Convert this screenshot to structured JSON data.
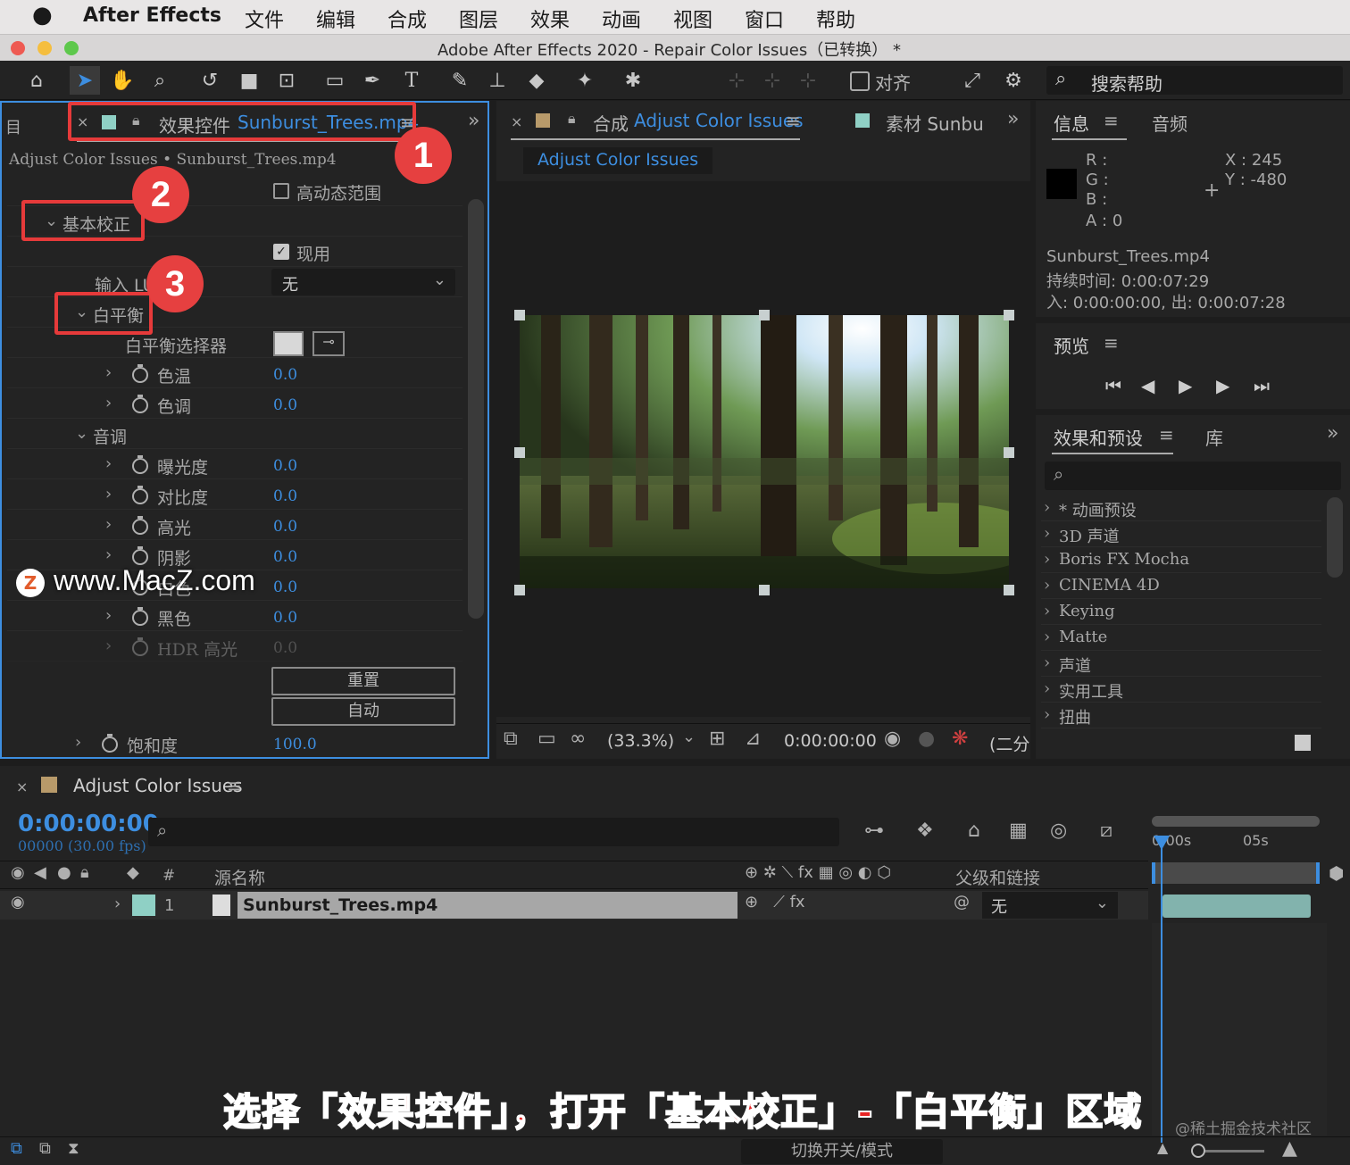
{
  "menubar": {
    "app_name": "After Effects",
    "items": [
      "文件",
      "编辑",
      "合成",
      "图层",
      "效果",
      "动画",
      "视图",
      "窗口",
      "帮助"
    ]
  },
  "window_title": "Adobe After Effects 2020 - Repair Color Issues（已转换） *",
  "toolbar": {
    "align_label": "对齐",
    "search_help": "搜索帮助"
  },
  "effect_controls": {
    "tab_prefix": "效果控件",
    "tab_file": "Sunburst_Trees.mp4",
    "breadcrumb": "Adjust Color Issues • Sunburst_Trees.mp4",
    "hdr_label": "高动态范围",
    "basic_correction": "基本校正",
    "enable_label": "现用",
    "input_lut_label": "输入 LUT",
    "input_lut_value": "无",
    "white_balance": "白平衡",
    "wb_picker": "白平衡选择器",
    "temperature": {
      "label": "色温",
      "value": "0.0"
    },
    "tint": {
      "label": "色调",
      "value": "0.0"
    },
    "tone": "音调",
    "exposure": {
      "label": "曝光度",
      "value": "0.0"
    },
    "contrast": {
      "label": "对比度",
      "value": "0.0"
    },
    "highlights": {
      "label": "高光",
      "value": "0.0"
    },
    "shadows": {
      "label": "阴影",
      "value": "0.0"
    },
    "whites": {
      "label": "白色",
      "value": "0.0"
    },
    "blacks": {
      "label": "黑色",
      "value": "0.0"
    },
    "hdr_highlights": {
      "label": "HDR 高光",
      "value": "0.0"
    },
    "reset_button": "重置",
    "auto_button": "自动",
    "saturation": {
      "label": "饱和度",
      "value": "100.0"
    }
  },
  "composition": {
    "tab_prefix": "合成",
    "tab_name": "Adjust Color Issues",
    "footage_tab": "素材 Sunbu",
    "sub_tab": "Adjust Color Issues",
    "zoom": "(33.3%)",
    "timecode": "0:00:00:00",
    "resolution": "(二分"
  },
  "info": {
    "tab": "信息",
    "audio_tab": "音频",
    "r": "R :",
    "g": "G :",
    "b": "B :",
    "a": "A :  0",
    "x": "X : 245",
    "y": "Y :  -480",
    "file": "Sunburst_Trees.mp4",
    "duration": "持续时间: 0:00:07:29",
    "inout": "入: 0:00:00:00,  出: 0:00:07:28"
  },
  "preview": {
    "tab": "预览"
  },
  "effects_presets": {
    "tab": "效果和预设",
    "library_tab": "库",
    "items": [
      "* 动画预设",
      "3D 声道",
      "Boris FX Mocha",
      "CINEMA 4D",
      "Keying",
      "Matte",
      "声道",
      "实用工具",
      "扭曲"
    ]
  },
  "timeline": {
    "comp_name": "Adjust Color Issues",
    "timecode": "0:00:00:00",
    "fps": "00000 (30.00 fps)",
    "col_hash": "#",
    "col_source": "源名称",
    "col_parent": "父级和链接",
    "layer_num": "1",
    "layer_name": "Sunburst_Trees.mp4",
    "parent_value": "无",
    "ruler_0": "0:00s",
    "ruler_5": "05s",
    "toggle_modes": "切换开关/模式"
  },
  "annotations": {
    "badge1": "1",
    "badge2": "2",
    "badge3": "3",
    "watermark": "www.MacZ.com",
    "caption": "选择「效果控件」，打开「基本校正」-「白平衡」区域",
    "credit": "@稀土掘金技术社区"
  },
  "colors": {
    "accent_blue": "#3d8ee0",
    "annotation_red": "#e63a3a",
    "panel_bg": "#232323"
  }
}
